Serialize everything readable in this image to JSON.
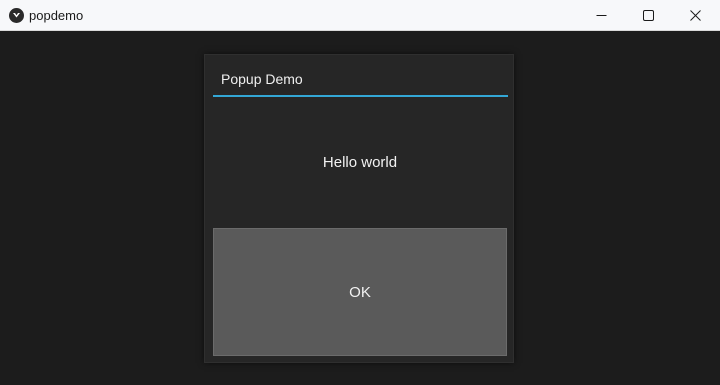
{
  "window": {
    "title": "popdemo",
    "icon": "kivy-logo-icon",
    "controls": [
      "minimize-icon",
      "maximize-icon",
      "close-icon"
    ]
  },
  "popup": {
    "title": "Popup Demo",
    "message": "Hello world",
    "button_label": "OK",
    "separator_color": "#33a7d6"
  },
  "colors": {
    "background": "#1c1c1c",
    "popup_background": "#262626",
    "button_background": "#5a5a5a",
    "titlebar": "#f7f8fa"
  }
}
